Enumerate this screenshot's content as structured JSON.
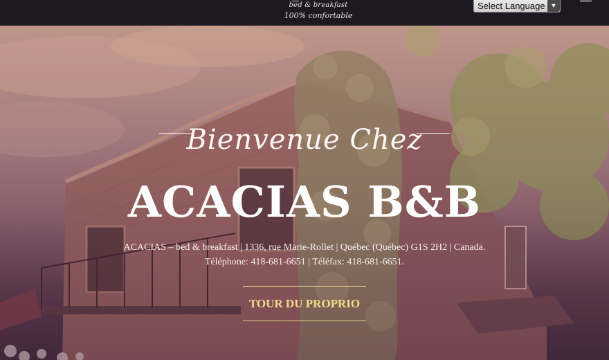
{
  "header": {
    "logo_line1": "bed & breakfast",
    "logo_line2": "100% confortable",
    "language_select": {
      "selected": "Select Language",
      "arrow": "▼"
    }
  },
  "hero": {
    "welcome": "Bienvenue Chez",
    "title": "ACACIAS B&B",
    "address": "ACACIAS – bed & breakfast | 1336, rue Marie-Rollet | Québec (Québec) G1S 2H2 | Canada.",
    "phone": "Téléphone: 418-681-6651 | Téléfax: 418-681-6651.",
    "tour_button": "TOUR DU PROPRIO"
  },
  "colors": {
    "topbar": "#1d1821",
    "accent_gold": "#f1dc8a",
    "hero_text": "#ffffff"
  }
}
